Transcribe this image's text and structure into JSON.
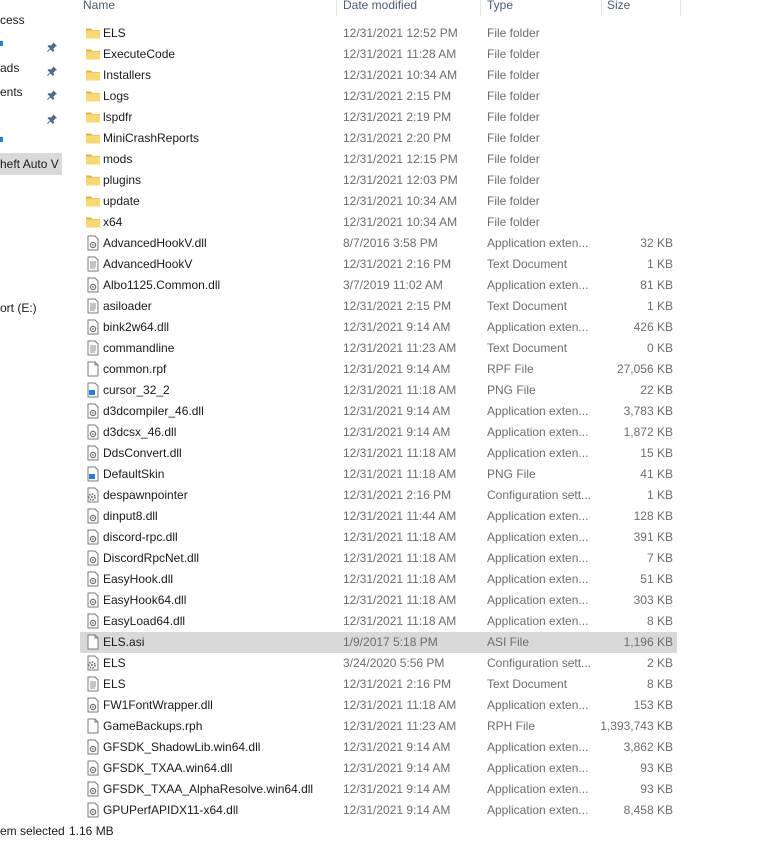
{
  "sidebar": {
    "items": [
      {
        "label": "cess",
        "pinned": false
      },
      {
        "label": "",
        "pinned": true
      },
      {
        "label": "ads",
        "pinned": true
      },
      {
        "label": "ents",
        "pinned": true
      },
      {
        "label": "",
        "pinned": true
      },
      {
        "label": "",
        "pinned": false
      },
      {
        "label": "heft Auto V",
        "pinned": false
      },
      {
        "label": "ort (E:)",
        "pinned": false
      }
    ]
  },
  "columns": {
    "name": "Name",
    "date": "Date modified",
    "type": "Type",
    "size": "Size"
  },
  "files": [
    {
      "name": "ELS",
      "date": "12/31/2021 12:52 PM",
      "type": "File folder",
      "size": "",
      "icon": "folder-icon"
    },
    {
      "name": "ExecuteCode",
      "date": "12/31/2021 11:28 AM",
      "type": "File folder",
      "size": "",
      "icon": "folder-icon"
    },
    {
      "name": "Installers",
      "date": "12/31/2021 10:34 AM",
      "type": "File folder",
      "size": "",
      "icon": "folder-icon"
    },
    {
      "name": "Logs",
      "date": "12/31/2021 2:15 PM",
      "type": "File folder",
      "size": "",
      "icon": "folder-icon"
    },
    {
      "name": "lspdfr",
      "date": "12/31/2021 2:19 PM",
      "type": "File folder",
      "size": "",
      "icon": "folder-icon"
    },
    {
      "name": "MiniCrashReports",
      "date": "12/31/2021 2:20 PM",
      "type": "File folder",
      "size": "",
      "icon": "folder-icon"
    },
    {
      "name": "mods",
      "date": "12/31/2021 12:15 PM",
      "type": "File folder",
      "size": "",
      "icon": "folder-icon"
    },
    {
      "name": "plugins",
      "date": "12/31/2021 12:03 PM",
      "type": "File folder",
      "size": "",
      "icon": "folder-icon"
    },
    {
      "name": "update",
      "date": "12/31/2021 10:34 AM",
      "type": "File folder",
      "size": "",
      "icon": "folder-icon"
    },
    {
      "name": "x64",
      "date": "12/31/2021 10:34 AM",
      "type": "File folder",
      "size": "",
      "icon": "folder-icon"
    },
    {
      "name": "AdvancedHookV.dll",
      "date": "8/7/2016 3:58 PM",
      "type": "Application exten...",
      "size": "32 KB",
      "icon": "dll-file-icon"
    },
    {
      "name": "AdvancedHookV",
      "date": "12/31/2021 2:16 PM",
      "type": "Text Document",
      "size": "1 KB",
      "icon": "text-file-icon"
    },
    {
      "name": "Albo1125.Common.dll",
      "date": "3/7/2019 11:02 AM",
      "type": "Application exten...",
      "size": "81 KB",
      "icon": "dll-file-icon"
    },
    {
      "name": "asiloader",
      "date": "12/31/2021 2:15 PM",
      "type": "Text Document",
      "size": "1 KB",
      "icon": "text-file-icon"
    },
    {
      "name": "bink2w64.dll",
      "date": "12/31/2021 9:14 AM",
      "type": "Application exten...",
      "size": "426 KB",
      "icon": "dll-file-icon"
    },
    {
      "name": "commandline",
      "date": "12/31/2021 11:23 AM",
      "type": "Text Document",
      "size": "0 KB",
      "icon": "text-file-icon"
    },
    {
      "name": "common.rpf",
      "date": "12/31/2021 9:14 AM",
      "type": "RPF File",
      "size": "27,056 KB",
      "icon": "blank-file-icon"
    },
    {
      "name": "cursor_32_2",
      "date": "12/31/2021 11:18 AM",
      "type": "PNG File",
      "size": "22 KB",
      "icon": "image-file-icon"
    },
    {
      "name": "d3dcompiler_46.dll",
      "date": "12/31/2021 9:14 AM",
      "type": "Application exten...",
      "size": "3,783 KB",
      "icon": "dll-file-icon"
    },
    {
      "name": "d3dcsx_46.dll",
      "date": "12/31/2021 9:14 AM",
      "type": "Application exten...",
      "size": "1,872 KB",
      "icon": "dll-file-icon"
    },
    {
      "name": "DdsConvert.dll",
      "date": "12/31/2021 11:18 AM",
      "type": "Application exten...",
      "size": "15 KB",
      "icon": "dll-file-icon"
    },
    {
      "name": "DefaultSkin",
      "date": "12/31/2021 11:18 AM",
      "type": "PNG File",
      "size": "41 KB",
      "icon": "image-file-icon"
    },
    {
      "name": "despawnpointer",
      "date": "12/31/2021 2:16 PM",
      "type": "Configuration sett...",
      "size": "1 KB",
      "icon": "config-file-icon"
    },
    {
      "name": "dinput8.dll",
      "date": "12/31/2021 11:44 AM",
      "type": "Application exten...",
      "size": "128 KB",
      "icon": "dll-file-icon"
    },
    {
      "name": "discord-rpc.dll",
      "date": "12/31/2021 11:18 AM",
      "type": "Application exten...",
      "size": "391 KB",
      "icon": "dll-file-icon"
    },
    {
      "name": "DiscordRpcNet.dll",
      "date": "12/31/2021 11:18 AM",
      "type": "Application exten...",
      "size": "7 KB",
      "icon": "dll-file-icon"
    },
    {
      "name": "EasyHook.dll",
      "date": "12/31/2021 11:18 AM",
      "type": "Application exten...",
      "size": "51 KB",
      "icon": "dll-file-icon"
    },
    {
      "name": "EasyHook64.dll",
      "date": "12/31/2021 11:18 AM",
      "type": "Application exten...",
      "size": "303 KB",
      "icon": "dll-file-icon"
    },
    {
      "name": "EasyLoad64.dll",
      "date": "12/31/2021 11:18 AM",
      "type": "Application exten...",
      "size": "8 KB",
      "icon": "dll-file-icon"
    },
    {
      "name": "ELS.asi",
      "date": "1/9/2017 5:18 PM",
      "type": "ASI File",
      "size": "1,196 KB",
      "icon": "blank-file-icon",
      "selected": true
    },
    {
      "name": "ELS",
      "date": "3/24/2020 5:56 PM",
      "type": "Configuration sett...",
      "size": "2 KB",
      "icon": "config-file-icon"
    },
    {
      "name": "ELS",
      "date": "12/31/2021 2:16 PM",
      "type": "Text Document",
      "size": "8 KB",
      "icon": "text-file-icon"
    },
    {
      "name": "FW1FontWrapper.dll",
      "date": "12/31/2021 11:18 AM",
      "type": "Application exten...",
      "size": "153 KB",
      "icon": "dll-file-icon"
    },
    {
      "name": "GameBackups.rph",
      "date": "12/31/2021 11:23 AM",
      "type": "RPH File",
      "size": "1,393,743 KB",
      "icon": "blank-file-icon"
    },
    {
      "name": "GFSDK_ShadowLib.win64.dll",
      "date": "12/31/2021 9:14 AM",
      "type": "Application exten...",
      "size": "3,862 KB",
      "icon": "dll-file-icon"
    },
    {
      "name": "GFSDK_TXAA.win64.dll",
      "date": "12/31/2021 9:14 AM",
      "type": "Application exten...",
      "size": "93 KB",
      "icon": "dll-file-icon"
    },
    {
      "name": "GFSDK_TXAA_AlphaResolve.win64.dll",
      "date": "12/31/2021 9:14 AM",
      "type": "Application exten...",
      "size": "93 KB",
      "icon": "dll-file-icon"
    },
    {
      "name": "GPUPerfAPIDX11-x64.dll",
      "date": "12/31/2021 9:14 AM",
      "type": "Application exten...",
      "size": "8,458 KB",
      "icon": "dll-file-icon"
    }
  ],
  "status": {
    "selection": "em selected",
    "size": "1.16 MB"
  },
  "colors": {
    "folder": "#f8d775",
    "folder_dark": "#e0b14a",
    "selected_row": "#d9d9d9",
    "pin": "#4a6b8a",
    "accent": "#2b7dd3"
  }
}
